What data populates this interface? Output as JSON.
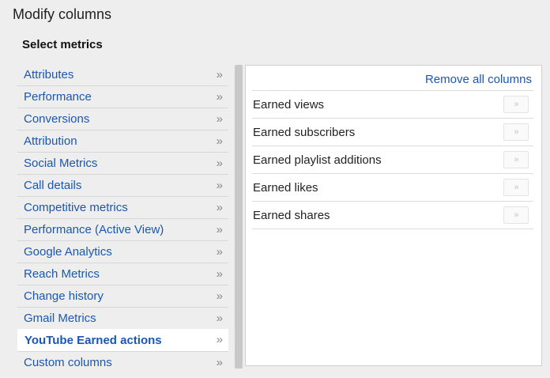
{
  "header": {
    "title": "Modify columns",
    "section_title": "Select metrics"
  },
  "icons": {
    "chevron": "double-chevron-right-icon"
  },
  "colors": {
    "link": "#1a57b3",
    "background": "#eeeeee",
    "panel": "#ffffff"
  },
  "categories": [
    {
      "label": "Attributes",
      "selected": false
    },
    {
      "label": "Performance",
      "selected": false
    },
    {
      "label": "Conversions",
      "selected": false
    },
    {
      "label": "Attribution",
      "selected": false
    },
    {
      "label": "Social Metrics",
      "selected": false
    },
    {
      "label": "Call details",
      "selected": false
    },
    {
      "label": "Competitive metrics",
      "selected": false
    },
    {
      "label": "Performance (Active View)",
      "selected": false
    },
    {
      "label": "Google Analytics",
      "selected": false
    },
    {
      "label": "Reach Metrics",
      "selected": false
    },
    {
      "label": "Change history",
      "selected": false
    },
    {
      "label": "Gmail Metrics",
      "selected": false
    },
    {
      "label": "YouTube Earned actions",
      "selected": true
    },
    {
      "label": "Custom columns",
      "selected": false
    }
  ],
  "metrics_panel": {
    "remove_all_label": "Remove all columns",
    "metrics": [
      {
        "label": "Earned views"
      },
      {
        "label": "Earned subscribers"
      },
      {
        "label": "Earned playlist additions"
      },
      {
        "label": "Earned likes"
      },
      {
        "label": "Earned shares"
      }
    ]
  }
}
